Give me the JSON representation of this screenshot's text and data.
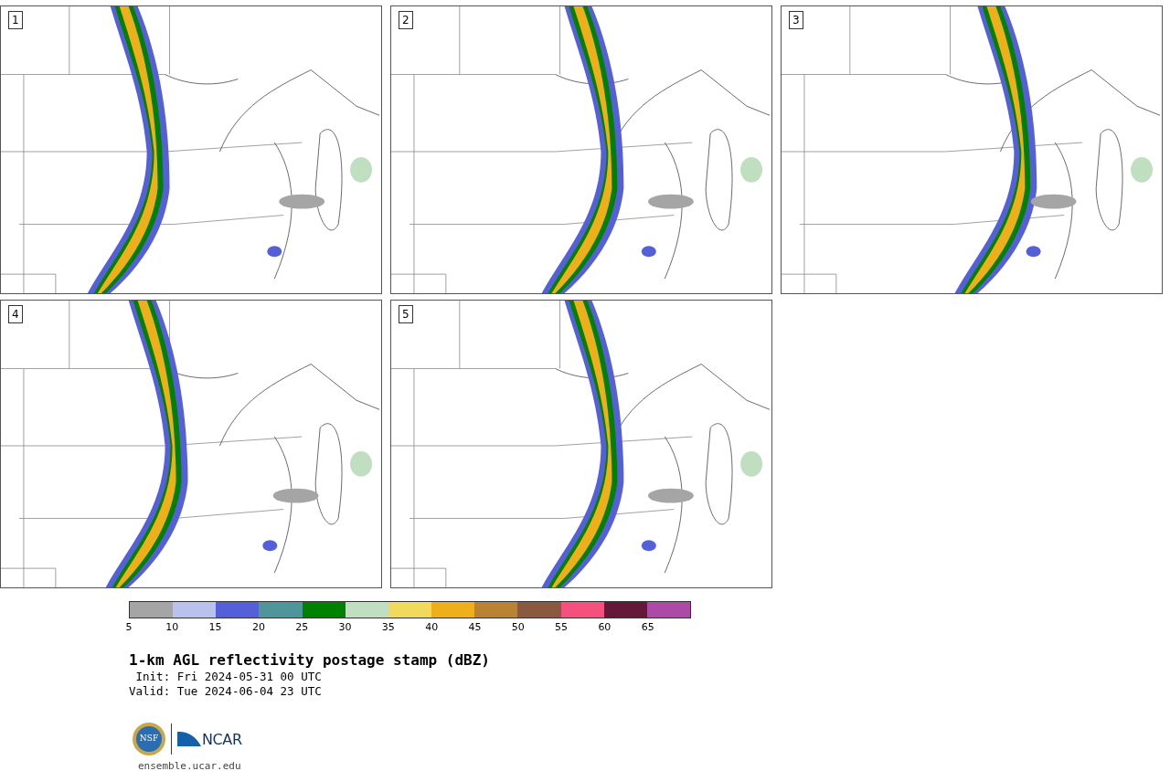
{
  "panels": [
    {
      "label": "1"
    },
    {
      "label": "2"
    },
    {
      "label": "3"
    },
    {
      "label": "4"
    },
    {
      "label": "5"
    }
  ],
  "colorbar": {
    "bins": [
      {
        "color": "#a5a5a5",
        "label": "5"
      },
      {
        "color": "#b8c2ec",
        "label": "10"
      },
      {
        "color": "#5560d8",
        "label": "15"
      },
      {
        "color": "#4f969b",
        "label": "20"
      },
      {
        "color": "#008200",
        "label": "25"
      },
      {
        "color": "#c0dec0",
        "label": "30"
      },
      {
        "color": "#efda5e",
        "label": "35"
      },
      {
        "color": "#efaf1a",
        "label": "40"
      },
      {
        "color": "#b98333",
        "label": "45"
      },
      {
        "color": "#8a5a40",
        "label": "50"
      },
      {
        "color": "#f4517e",
        "label": "55"
      },
      {
        "color": "#641938",
        "label": "60"
      },
      {
        "color": "#ad4aa5",
        "label": "65"
      }
    ]
  },
  "title": "1-km AGL reflectivity postage stamp (dBZ)",
  "init": " Init: Fri 2024-05-31 00 UTC",
  "valid": "Valid: Tue 2024-06-04 23 UTC",
  "logos": {
    "nsf": "NSF",
    "ncar": "NCAR"
  },
  "url": "ensemble.ucar.edu"
}
